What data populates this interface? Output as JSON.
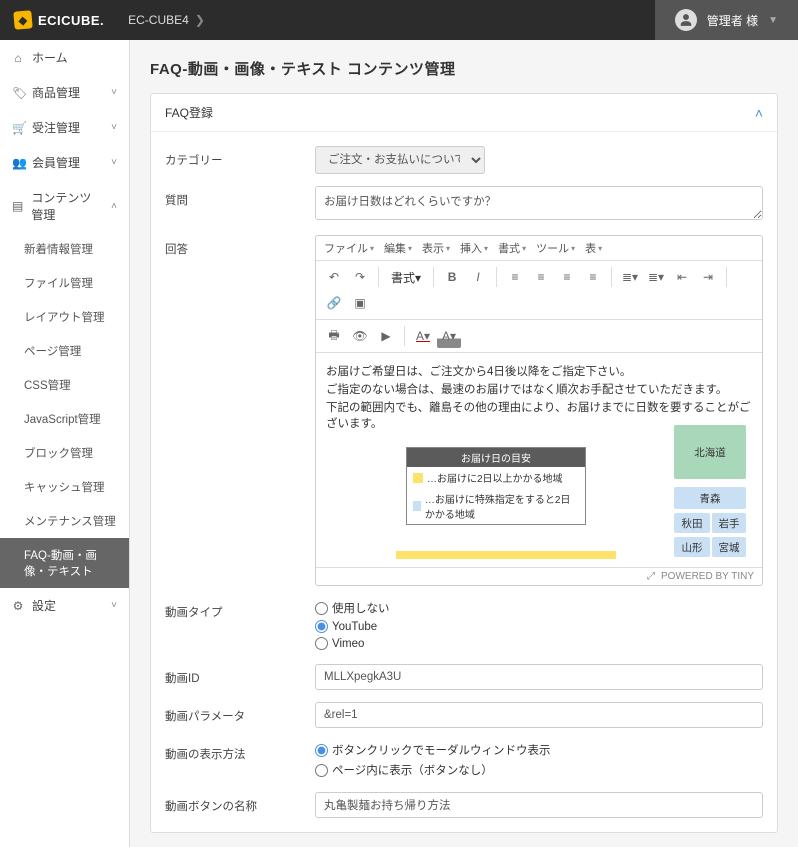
{
  "brand": "ECICUBE.",
  "crumb": {
    "root": "EC-CUBE4"
  },
  "user": "管理者 様",
  "sidebar": {
    "items": [
      {
        "label": "ホーム",
        "icon": "home",
        "chev": ""
      },
      {
        "label": "商品管理",
        "icon": "tag",
        "chev": "˅"
      },
      {
        "label": "受注管理",
        "icon": "cart",
        "chev": "˅"
      },
      {
        "label": "会員管理",
        "icon": "users",
        "chev": "˅"
      },
      {
        "label": "コンテンツ管理",
        "icon": "doc",
        "chev": "˄"
      }
    ],
    "children": [
      "新着情報管理",
      "ファイル管理",
      "レイアウト管理",
      "ページ管理",
      "CSS管理",
      "JavaScript管理",
      "ブロック管理",
      "キャッシュ管理",
      "メンテナンス管理",
      "FAQ-動画・画像・テキスト"
    ],
    "after": [
      {
        "label": "設定",
        "icon": "gear",
        "chev": "˅"
      }
    ]
  },
  "page_title": "FAQ-動画・画像・テキスト コンテンツ管理",
  "card_title": "FAQ登録",
  "labels": {
    "category": "カテゴリー",
    "question": "質問",
    "answer": "回答",
    "movie_type": "動画タイプ",
    "movie_id": "動画ID",
    "movie_param": "動画パラメータ",
    "movie_view": "動画の表示方法",
    "movie_btn": "動画ボタンの名称"
  },
  "values": {
    "category_selected": "ご注文・お支払いについて",
    "question": "お届け日数はどれくらいですか？",
    "movie_id": "MLLXpegkA3U",
    "movie_param": "&rel=1",
    "movie_btn": "丸亀製麺お持ち帰り方法"
  },
  "movie_type_options": {
    "none": "使用しない",
    "youtube": "YouTube",
    "vimeo": "Vimeo"
  },
  "movie_view_options": {
    "modal": "ボタンクリックでモーダルウィンドウ表示",
    "inpage": "ページ内に表示（ボタンなし）"
  },
  "editor": {
    "menus": [
      "ファイル",
      "編集",
      "表示",
      "挿入",
      "書式",
      "ツール",
      "表"
    ],
    "style_dd": "書式",
    "content": {
      "l1": "お届けご希望日は、ご注文から4日後以降をご指定下さい。",
      "l2": "ご指定のない場合は、最速のお届けではなく順次お手配させていただきます。",
      "l3": "下記の範囲内でも、離島その他の理由により、お届けまでに日数を要することがございます。",
      "legend_title": "お届け日の目安",
      "legend_a": "…お届けに2日以上かかる地域",
      "legend_b": "…お届けに特殊指定をすると2日かかる地域",
      "tiles": {
        "hokkaido": "北海道",
        "aomori": "青森",
        "akita": "秋田",
        "iwate": "岩手",
        "yamagata": "山形",
        "miyagi": "宮城"
      }
    },
    "footer_icon": "⤢",
    "footer": "POWERED BY TINY"
  }
}
